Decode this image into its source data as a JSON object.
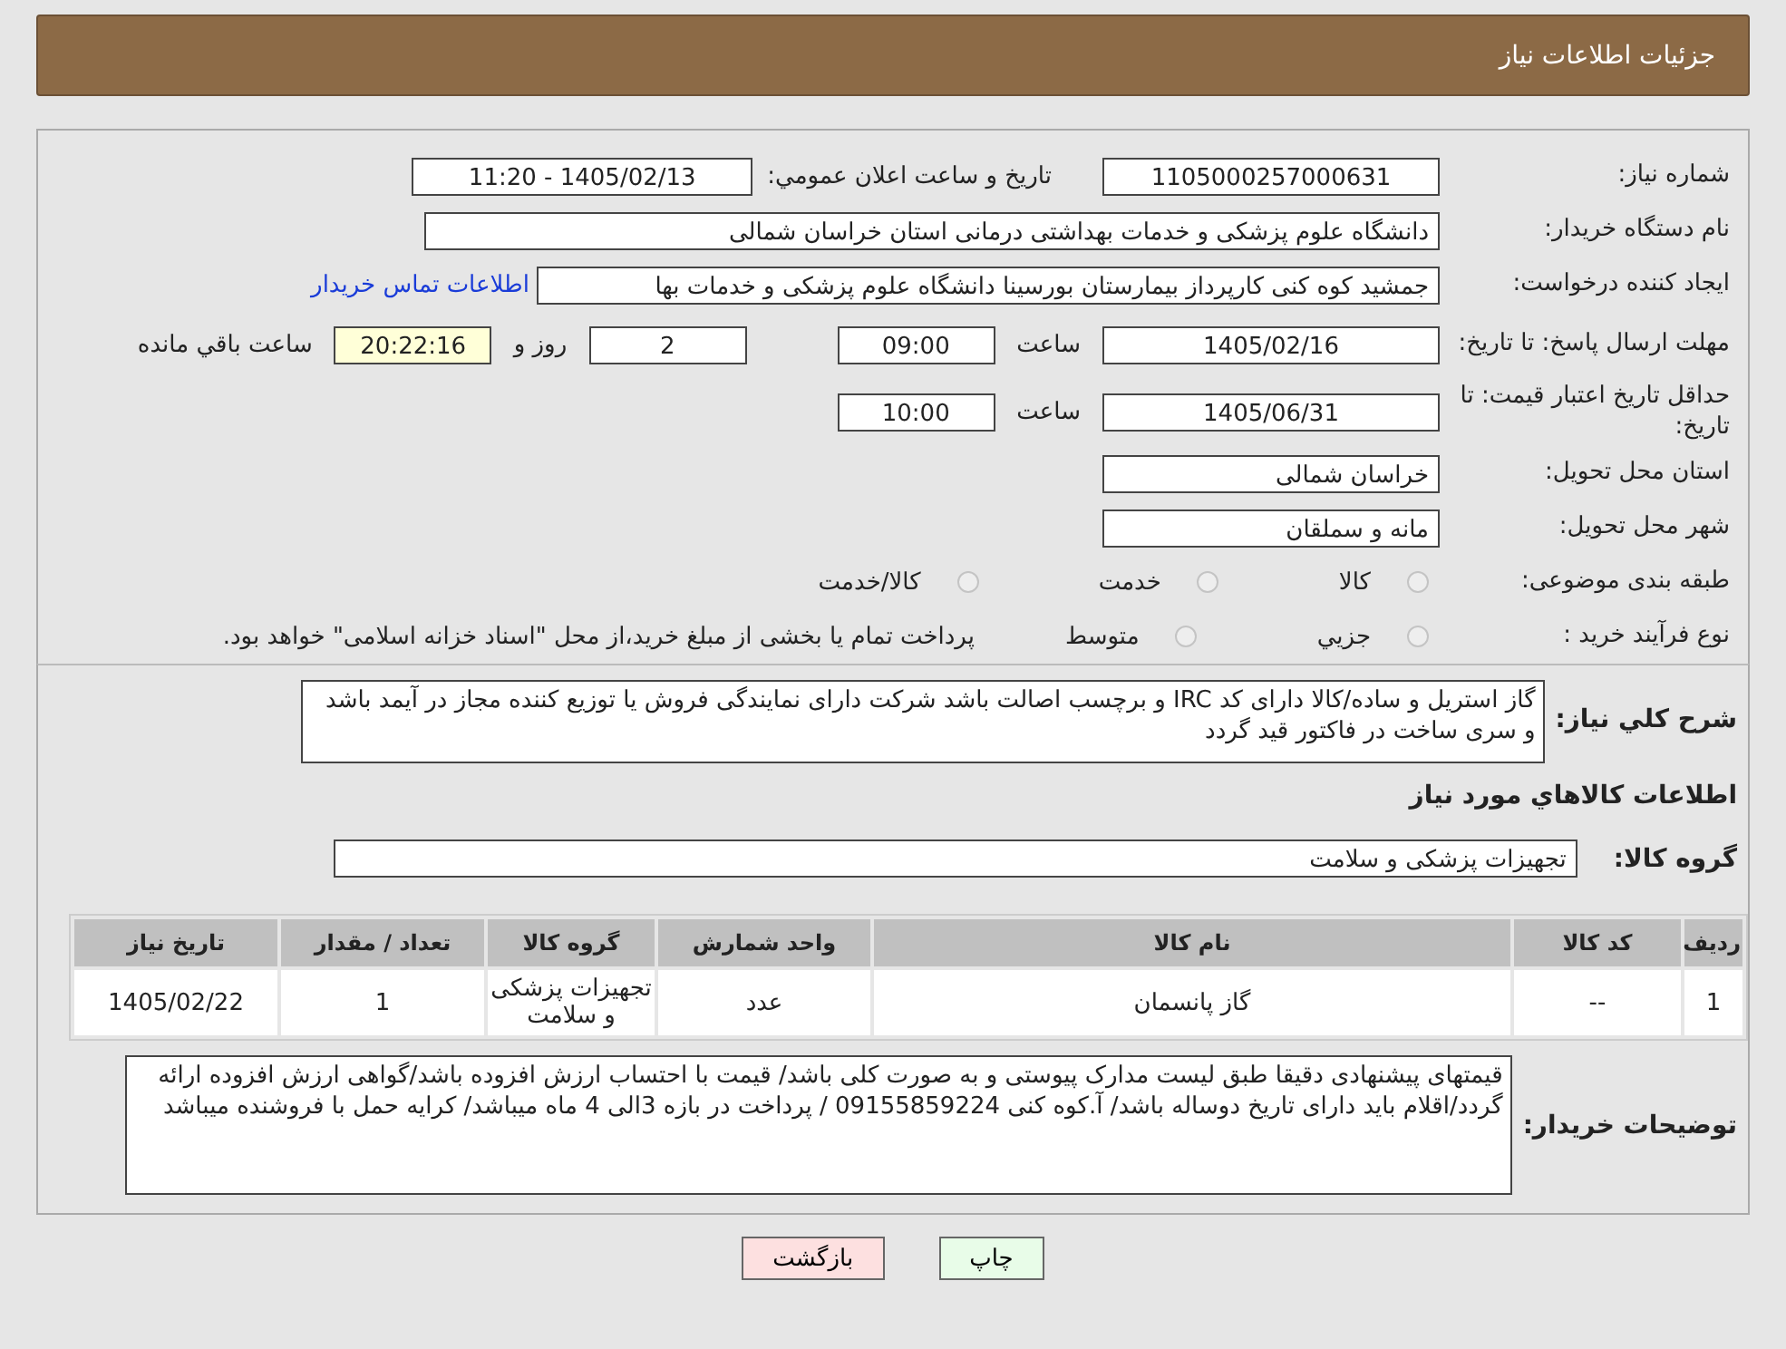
{
  "header": {
    "title": "جزئیات اطلاعات نیاز"
  },
  "need_number": {
    "label": "شماره نیاز:",
    "value": "1105000257000631"
  },
  "announce": {
    "label": "تاریخ و ساعت اعلان عمومي:",
    "value": "1405/02/13 - 11:20"
  },
  "buyer": {
    "label": "نام دستگاه خریدار:",
    "value": "دانشگاه علوم پزشکی و خدمات بهداشتی درمانی استان خراسان شمالی"
  },
  "requester": {
    "label": "ایجاد کننده درخواست:",
    "value": "جمشید کوه کنی کارپرداز بیمارستان بورسینا دانشگاه علوم پزشکی و خدمات بها",
    "link": "اطلاعات تماس خریدار"
  },
  "deadline": {
    "label": "مهلت ارسال پاسخ: تا تاریخ:",
    "date": "1405/02/16",
    "time_label": "ساعت",
    "time": "09:00",
    "days": "2",
    "days_label": "روز و",
    "remaining": "20:22:16",
    "remaining_label": "ساعت باقي مانده"
  },
  "validity": {
    "label": "حداقل تاریخ اعتبار قیمت: تا تاریخ:",
    "date": "1405/06/31",
    "time_label": "ساعت",
    "time": "10:00"
  },
  "province": {
    "label": "استان محل تحویل:",
    "value": "خراسان شمالی"
  },
  "city": {
    "label": "شهر محل تحویل:",
    "value": "مانه و سملقان"
  },
  "category": {
    "label": "طبقه بندی موضوعی:",
    "options": [
      {
        "label": "کالا",
        "selected": false
      },
      {
        "label": "خدمت",
        "selected": false
      },
      {
        "label": "کالا/خدمت",
        "selected": false
      }
    ]
  },
  "purchase_type": {
    "label": "نوع فرآیند خرید :",
    "options": [
      {
        "label": "جزيي",
        "selected": false
      },
      {
        "label": "متوسط",
        "selected": false
      }
    ],
    "note": "پرداخت تمام یا بخشی از مبلغ خرید،از محل \"اسناد خزانه اسلامی\" خواهد بود."
  },
  "description": {
    "label": "شرح کلي نیاز:",
    "value": "گاز استریل و ساده/کالا دارای کد IRC و برچسب اصالت باشد شرکت دارای نمایندگی فروش یا توزیع کننده مجاز در آیمد باشد و سری ساخت در فاکتور قید گردد"
  },
  "items_title": "اطلاعات کالاهاي مورد نیاز",
  "goods_group": {
    "label": "گروه کالا:",
    "value": "تجهیزات پزشکی و سلامت"
  },
  "table": {
    "columns": [
      "ردیف",
      "کد کالا",
      "نام کالا",
      "واحد شمارش",
      "گروه کالا",
      "تعداد / مقدار",
      "تاریخ نیاز"
    ],
    "rows": [
      [
        "1",
        "--",
        "گاز پانسمان",
        "عدد",
        "تجهیزات پزشکی و سلامت",
        "1",
        "1405/02/22"
      ]
    ]
  },
  "buyer_notes": {
    "label": "توضیحات خریدار:",
    "value": "قیمتهای پیشنهادی دقیقا طبق لیست مدارک پیوستی و به صورت کلی باشد/ قیمت با احتساب ارزش افزوده باشد/گواهی ارزش افزوده ارائه گردد/اقلام باید دارای تاریخ دوساله باشد/ آ.کوه کنی 09155859224 / پرداخت در بازه 3الی 4 ماه میباشد/ کرایه حمل با فروشنده میباشد"
  },
  "buttons": [
    {
      "label": "چاپ",
      "kind": "print"
    },
    {
      "label": "بازگشت",
      "kind": "back"
    }
  ]
}
